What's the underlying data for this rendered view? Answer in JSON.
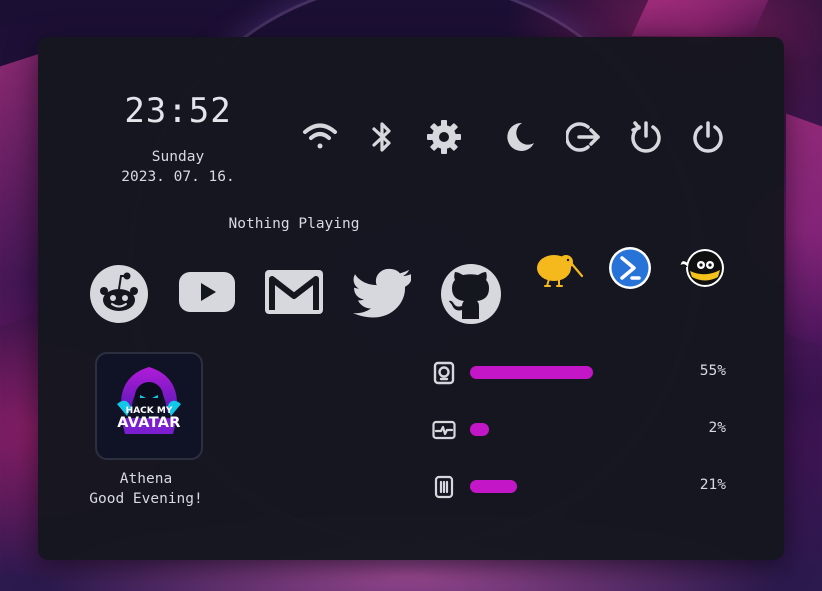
{
  "clock": {
    "time": "23:52",
    "day": "Sunday",
    "date": "2023. 07. 16."
  },
  "music": {
    "status": "Nothing Playing"
  },
  "system_buttons": [
    "wifi-icon",
    "bluetooth-icon",
    "settings-gear-icon",
    "moon-icon",
    "logout-icon",
    "restart-icon",
    "power-icon"
  ],
  "apps": [
    "reddit-icon",
    "youtube-icon",
    "gmail-icon",
    "twitter-icon",
    "github-icon",
    "kiwi-icon",
    "powershell-icon",
    "hacker-mascot-icon"
  ],
  "profile": {
    "avatar_brand_top": "HACK MY",
    "avatar_brand_bottom": "AVATAR",
    "name": "Athena",
    "greeting": "Good Evening!"
  },
  "stats": [
    {
      "icon": "disk-icon",
      "value": 0.55,
      "label": "55%"
    },
    {
      "icon": "cpu-monitor-icon",
      "value": 0.02,
      "label": "2%"
    },
    {
      "icon": "memory-icon",
      "value": 0.21,
      "label": "21%"
    }
  ],
  "colors": {
    "panel": "#15171f",
    "accent": "#c316c6",
    "icon": "#d6d8de",
    "text": "#d8dae0"
  }
}
